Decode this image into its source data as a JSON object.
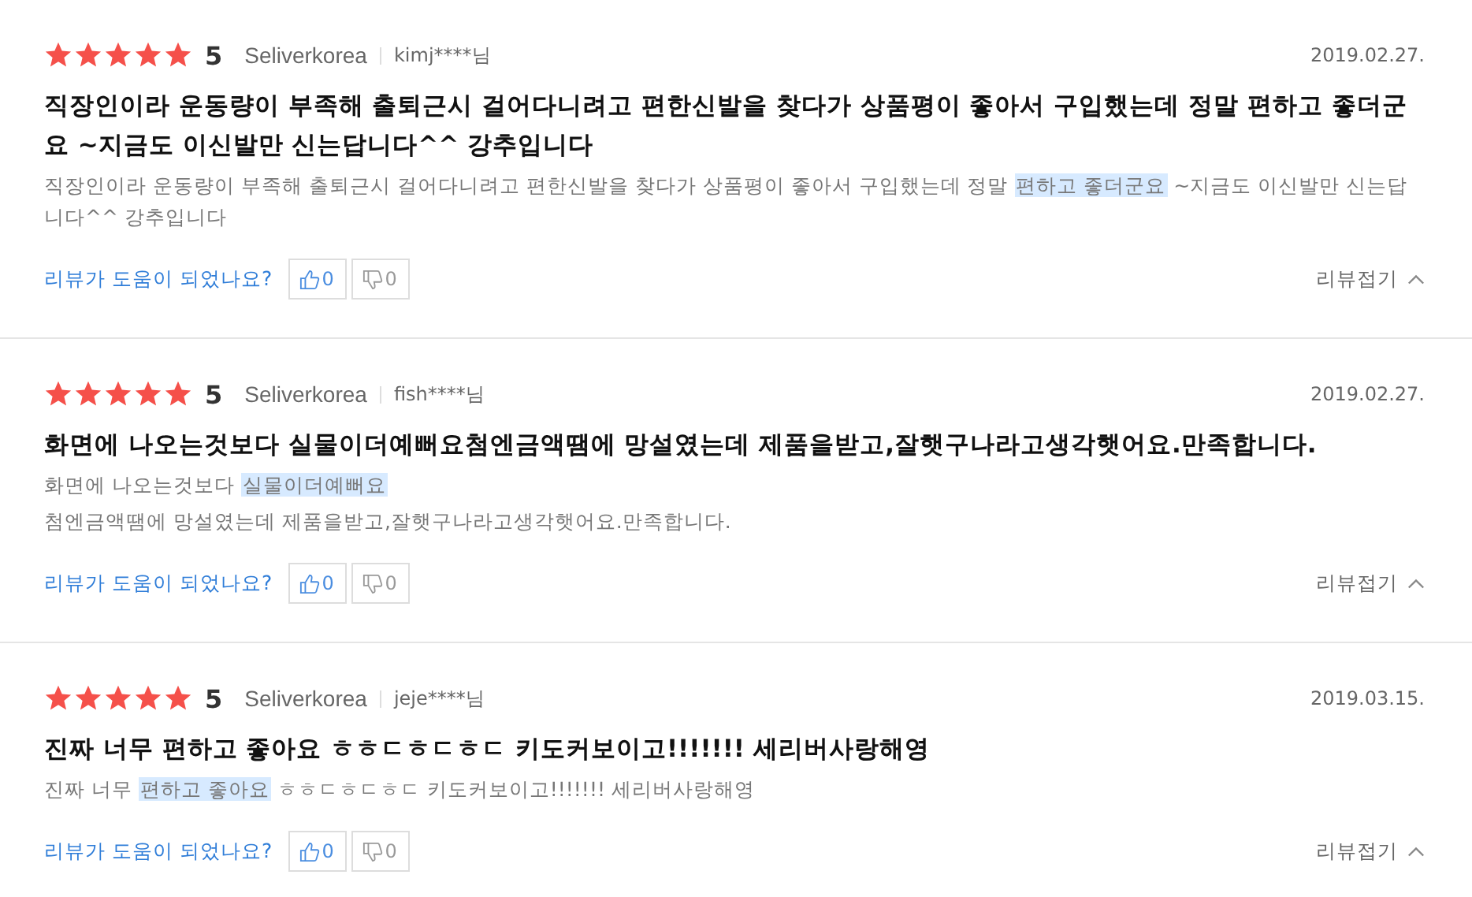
{
  "reviews": [
    {
      "stars": 5,
      "score": "5",
      "seller": "Seliverkorea",
      "user": "kimj****님",
      "date": "2019.02.27.",
      "title": "직장인이라 운동량이 부족해 출퇴근시 걸어다니려고 편한신발을 찾다가 상품평이 좋아서 구입했는데 정말 편하고 좋더군요 ~지금도 이신발만 신는답니다^^ 강추입니다",
      "body": [
        [
          {
            "text": "직장인이라 운동량이 부족해 출퇴근시 걸어다니려고 편한신발을 찾다가 상품평이 좋아서 구입했는데 정말 ",
            "highlighted": false
          },
          {
            "text": "편하고 좋더군요",
            "highlighted": true
          },
          {
            "text": " ~지금도 이신발만 신는답니다^^ 강추입니다",
            "highlighted": false
          }
        ]
      ],
      "helpful_question": "리뷰가 도움이 되었나요?",
      "likes": "0",
      "dislikes": "0",
      "collapse": "리뷰접기"
    },
    {
      "stars": 5,
      "score": "5",
      "seller": "Seliverkorea",
      "user": "fish****님",
      "date": "2019.02.27.",
      "title": "화면에 나오는것보다 실물이더예뻐요첨엔금액땜에 망설였는데 제품을받고,잘햇구나라고생각햇어요.만족합니다.",
      "body": [
        [
          {
            "text": "화면에 나오는것보다 ",
            "highlighted": false
          },
          {
            "text": "실물이더예뻐요",
            "highlighted": true
          }
        ],
        [
          {
            "text": "첨엔금액땜에 망설였는데 제품을받고,잘햇구나라고생각햇어요.만족합니다.",
            "highlighted": false
          }
        ]
      ],
      "helpful_question": "리뷰가 도움이 되었나요?",
      "likes": "0",
      "dislikes": "0",
      "collapse": "리뷰접기"
    },
    {
      "stars": 5,
      "score": "5",
      "seller": "Seliverkorea",
      "user": "jeje****님",
      "date": "2019.03.15.",
      "title": "진짜 너무 편하고 좋아요 ㅎㅎㄷㅎㄷㅎㄷ 키도커보이고!!!!!!! 세리버사랑해영",
      "body": [
        [
          {
            "text": "진짜 너무 ",
            "highlighted": false
          },
          {
            "text": "편하고 좋아요",
            "highlighted": true
          },
          {
            "text": " ㅎㅎㄷㅎㄷㅎㄷ 키도커보이고!!!!!!! 세리버사랑해영",
            "highlighted": false
          }
        ]
      ],
      "helpful_question": "리뷰가 도움이 되었나요?",
      "likes": "0",
      "dislikes": "0",
      "collapse": "리뷰접기"
    }
  ]
}
